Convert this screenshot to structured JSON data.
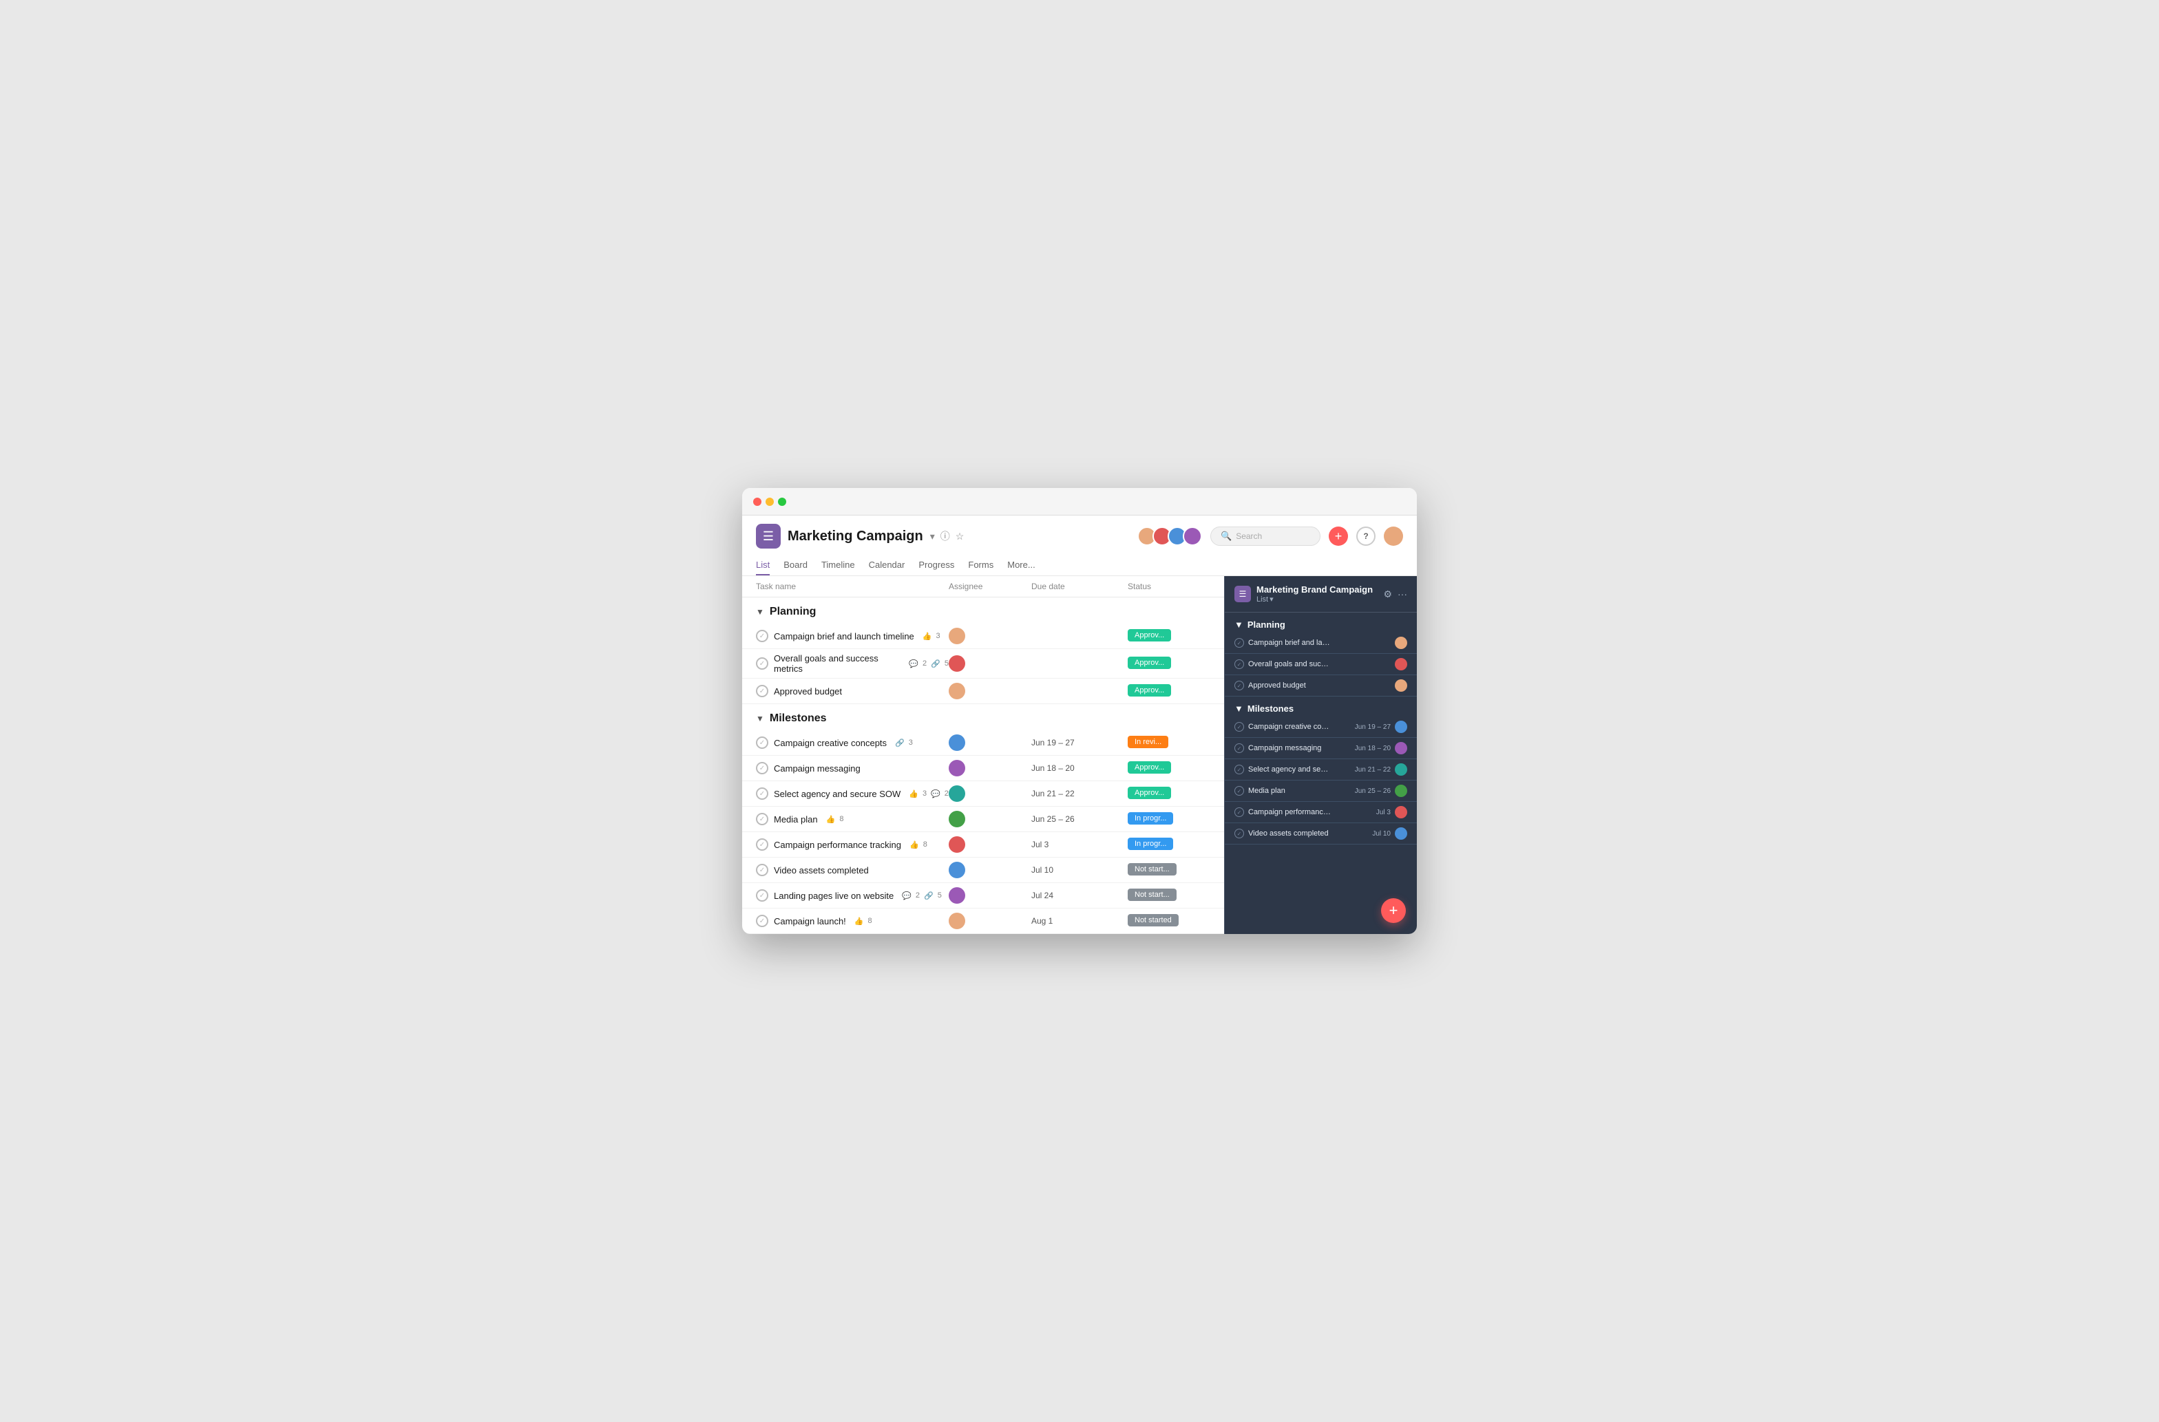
{
  "window": {
    "title": "Marketing Campaign"
  },
  "header": {
    "app_name": "Marketing Campaign",
    "nav_tabs": [
      "List",
      "Board",
      "Timeline",
      "Calendar",
      "Progress",
      "Forms",
      "More..."
    ],
    "active_tab": "List",
    "search_placeholder": "Search"
  },
  "table": {
    "columns": [
      "Task name",
      "Assignee",
      "Due date",
      "Status"
    ],
    "sections": [
      {
        "name": "Planning",
        "tasks": [
          {
            "name": "Campaign brief and launch timeline",
            "meta": "👍 3",
            "meta2": "",
            "assignee_color": "av-orange",
            "due": "",
            "status": "Approved",
            "status_class": "status-approved"
          },
          {
            "name": "Overall goals and success metrics",
            "meta": "💬 2",
            "meta2": "🔗 5",
            "assignee_color": "av-red",
            "due": "",
            "status": "Approved",
            "status_class": "status-approved"
          },
          {
            "name": "Approved budget",
            "meta": "",
            "meta2": "",
            "assignee_color": "av-orange",
            "due": "",
            "status": "Approved",
            "status_class": "status-approved"
          }
        ]
      },
      {
        "name": "Milestones",
        "tasks": [
          {
            "name": "Campaign creative concepts",
            "meta": "🔗 3",
            "meta2": "",
            "assignee_color": "av-blue",
            "due": "Jun 19 – 27",
            "status": "In review",
            "status_class": "status-inreview"
          },
          {
            "name": "Campaign messaging",
            "meta": "",
            "meta2": "",
            "assignee_color": "av-purple",
            "due": "Jun 18 – 20",
            "status": "Approved",
            "status_class": "status-approved"
          },
          {
            "name": "Select agency and secure SOW",
            "meta": "👍 3",
            "meta2": "💬 2",
            "assignee_color": "av-teal",
            "due": "Jun 21 – 22",
            "status": "Approved",
            "status_class": "status-approved"
          },
          {
            "name": "Media plan",
            "meta": "👍 8",
            "meta2": "",
            "assignee_color": "av-green",
            "due": "Jun 25 – 26",
            "status": "In progress",
            "status_class": "status-inprogress"
          },
          {
            "name": "Campaign performance tracking",
            "meta": "👍 8",
            "meta2": "",
            "assignee_color": "av-red",
            "due": "Jul 3",
            "status": "In progress",
            "status_class": "status-inprogress"
          },
          {
            "name": "Video assets completed",
            "meta": "",
            "meta2": "",
            "assignee_color": "av-blue",
            "due": "Jul 10",
            "status": "Not started",
            "status_class": "status-notstarted"
          },
          {
            "name": "Landing pages live on website",
            "meta": "💬 2",
            "meta2": "🔗 5",
            "assignee_color": "av-purple",
            "due": "Jul 24",
            "status": "Not started",
            "status_class": "status-notstarted"
          },
          {
            "name": "Campaign launch!",
            "meta": "👍 8",
            "meta2": "",
            "assignee_color": "av-orange",
            "due": "Aug 1",
            "status": "Not started",
            "status_class": "status-notstarted"
          }
        ]
      }
    ]
  },
  "sidebar": {
    "title": "Marketing Brand Campaign",
    "subtitle": "List",
    "sections": [
      {
        "name": "Planning",
        "tasks": [
          {
            "name": "Campaign brief and launch timeline",
            "date": "",
            "avatar_color": "av-orange"
          },
          {
            "name": "Overall goals and success metrics",
            "date": "",
            "avatar_color": "av-red"
          },
          {
            "name": "Approved budget",
            "date": "",
            "avatar_color": "av-orange"
          }
        ]
      },
      {
        "name": "Milestones",
        "tasks": [
          {
            "name": "Campaign creative conc...",
            "date": "Jun 19 – 27",
            "avatar_color": "av-blue"
          },
          {
            "name": "Campaign messaging",
            "date": "Jun 18 – 20",
            "avatar_color": "av-purple"
          },
          {
            "name": "Select agency and secu...",
            "date": "Jun 21 – 22",
            "avatar_color": "av-teal"
          },
          {
            "name": "Media plan",
            "date": "Jun 25 – 26",
            "avatar_color": "av-green"
          },
          {
            "name": "Campaign performance track...",
            "date": "Jul 3",
            "avatar_color": "av-red"
          },
          {
            "name": "Video assets completed",
            "date": "Jul 10",
            "avatar_color": "av-blue"
          }
        ]
      }
    ]
  },
  "icons": {
    "check": "✓",
    "chevron_down": "▼",
    "plus": "+",
    "search": "🔍",
    "help": "?",
    "info": "ⓘ",
    "star": "☆",
    "filter": "⚙",
    "more": "···"
  }
}
